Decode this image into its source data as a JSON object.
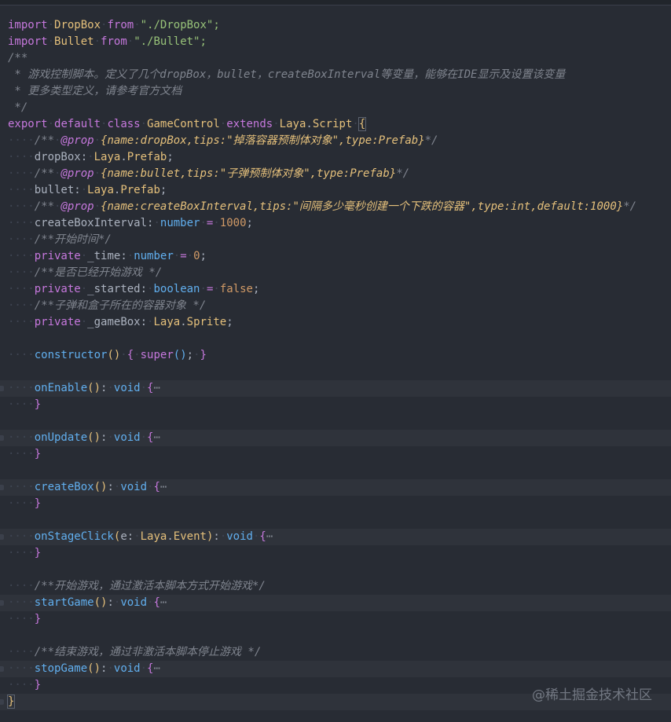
{
  "lines": {
    "l1": [
      "import",
      "DropBox",
      "from",
      "\"./DropBox\";"
    ],
    "l2": [
      "import",
      "Bullet",
      "from",
      "\"./Bullet\";"
    ],
    "l3": "/**",
    "l4": " * 游戏控制脚本。定义了几个dropBox，bullet，createBoxInterval等变量，能够在IDE显示及设置该变量",
    "l5": " * 更多类型定义，请参考官方文档",
    "l6": " */",
    "l7": [
      "export",
      "default",
      "class",
      "GameControl",
      "extends",
      "Laya",
      "Script",
      "{"
    ],
    "l8": [
      "/**",
      "@prop",
      "{name:dropBox,tips:\"掉落容器预制体对象\",type:Prefab}",
      "*/"
    ],
    "l9": [
      "dropBox",
      "Laya",
      "Prefab"
    ],
    "l10": [
      "/**",
      "@prop",
      "{name:bullet,tips:\"子弹预制体对象\",type:Prefab}",
      "*/"
    ],
    "l11": [
      "bullet",
      "Laya",
      "Prefab"
    ],
    "l12": [
      "/**",
      "@prop",
      "{name:createBoxInterval,tips:\"间隔多少毫秒创建一个下跌的容器\",type:int,default:1000}",
      "*/"
    ],
    "l13": [
      "createBoxInterval",
      "number",
      "1000"
    ],
    "l14": "/**开始时间*/",
    "l15": [
      "private",
      "_time",
      "number",
      "0"
    ],
    "l16": "/**是否已经开始游戏 */",
    "l17": [
      "private",
      "_started",
      "boolean",
      "false"
    ],
    "l18": "/**子弹和盒子所在的容器对象 */",
    "l19": [
      "private",
      "_gameBox",
      "Laya",
      "Sprite"
    ],
    "l20": [
      "constructor",
      "super"
    ],
    "l21": [
      "onEnable",
      "void"
    ],
    "l22": [
      "onUpdate",
      "void"
    ],
    "l23": [
      "createBox",
      "void"
    ],
    "l24": [
      "onStageClick",
      "e",
      "Laya",
      "Event",
      "void"
    ],
    "l25": "/**开始游戏，通过激活本脚本方式开始游戏*/",
    "l26": [
      "startGame",
      "void"
    ],
    "l27": "/**结束游戏，通过非激活本脚本停止游戏 */",
    "l28": [
      "stopGame",
      "void"
    ],
    "ellipsis": "⋯",
    "close_brace": "}"
  },
  "watermark": "@稀土掘金技术社区",
  "colors": {
    "background": "#282c34",
    "keyword": "#c678dd",
    "type": "#e5c07b",
    "function": "#61afef",
    "string": "#98c379",
    "number": "#d19a66",
    "comment": "#7f848e"
  }
}
